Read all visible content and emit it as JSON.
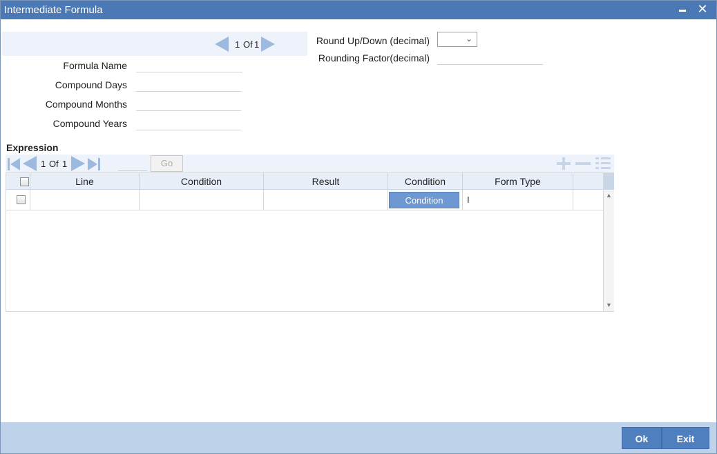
{
  "window": {
    "title": "Intermediate Formula",
    "minimize_glyph": "",
    "close_glyph": "✕"
  },
  "record_pager": {
    "current": "1",
    "of_label": "Of",
    "total": "1"
  },
  "form": {
    "formula_name_label": "Formula Name",
    "formula_name_value": "",
    "compound_days_label": "Compound Days",
    "compound_days_value": "",
    "compound_months_label": "Compound Months",
    "compound_months_value": "",
    "compound_years_label": "Compound Years",
    "compound_years_value": "",
    "round_updown_label": "Round Up/Down (decimal)",
    "round_updown_value": "",
    "rounding_factor_label": "Rounding Factor(decimal)",
    "rounding_factor_value": ""
  },
  "expression": {
    "title": "Expression",
    "pager": {
      "current": "1",
      "of_label": "Of",
      "total": "1"
    },
    "go_input_value": "",
    "go_label": "Go",
    "columns": [
      "Line",
      "Condition",
      "Result",
      "Condition",
      "Form Type"
    ],
    "rows": [
      {
        "line": "",
        "condition": "",
        "result": "",
        "condition_button": "Condition",
        "form_type": "I"
      }
    ]
  },
  "footer": {
    "ok_label": "Ok",
    "exit_label": "Exit"
  },
  "colors": {
    "titlebar": "#4a79b6",
    "accent_button": "#4f7fbf",
    "footer_band": "#bed3ea",
    "pager_arrow": "#9db9dd"
  }
}
